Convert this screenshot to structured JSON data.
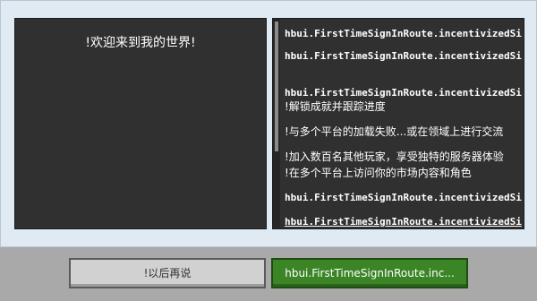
{
  "left_panel": {
    "title": "!欢迎来到我的世界!"
  },
  "right_panel": {
    "lines": [
      "hbui.FirstTimeSignInRoute.incentivizedSi",
      "hbui.FirstTimeSignInRoute.incentivizedSi",
      "",
      "hbui.FirstTimeSignInRoute.incentivizedSi",
      "!解锁成就并跟踪进度",
      "",
      "!与多个平台的加载失败...或在领域上进行交流",
      "",
      "!加入数百名其他玩家，享受独特的服务器体验",
      "!在多个平台上访问你的市场内容和角色",
      "hbui.FirstTimeSignInRoute.incentivizedSi",
      "hbui.FirstTimeSignInRoute.incentivizedSi"
    ]
  },
  "buttons": {
    "later_label": "!以后再说",
    "confirm_label": "hbui.FirstTimeSignInRoute.inc..."
  },
  "colors": {
    "panel_bg": "#303030",
    "dialog_bg": "#dfeaf3",
    "confirm_green": "#3c8527",
    "later_gray": "#d1d1d1"
  }
}
